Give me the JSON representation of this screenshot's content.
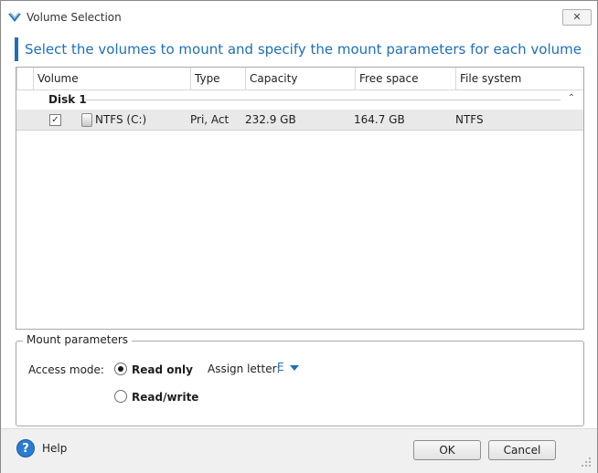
{
  "window": {
    "title": "Volume Selection",
    "close_label": "✕"
  },
  "heading": "Select the volumes to mount and specify the mount parameters for each volume",
  "table": {
    "columns": [
      "Volume",
      "Type",
      "Capacity",
      "Free space",
      "File system"
    ],
    "groups": [
      {
        "name": "Disk 1",
        "rows": [
          {
            "checked": true,
            "volume": "NTFS (C:)",
            "type": "Pri, Act",
            "capacity": "232.9 GB",
            "free_space": "164.7 GB",
            "file_system": "NTFS"
          }
        ]
      }
    ]
  },
  "mount_params": {
    "legend": "Mount parameters",
    "access_mode_label": "Access mode:",
    "options": [
      "Read only",
      "Read/write"
    ],
    "selected": "Read only",
    "assign_letter_label": "Assign letter:",
    "letter": "E"
  },
  "footer": {
    "help": "Help",
    "ok": "OK",
    "cancel": "Cancel"
  },
  "colors": {
    "accent": "#1e6fb8",
    "selected_row": "#e9e9e9"
  },
  "icons": {
    "app": "acronis-logo-icon",
    "help": "help-icon",
    "drive": "drive-icon",
    "collapse": "collapse-up-icon",
    "checkbox": "checkmark-icon"
  }
}
